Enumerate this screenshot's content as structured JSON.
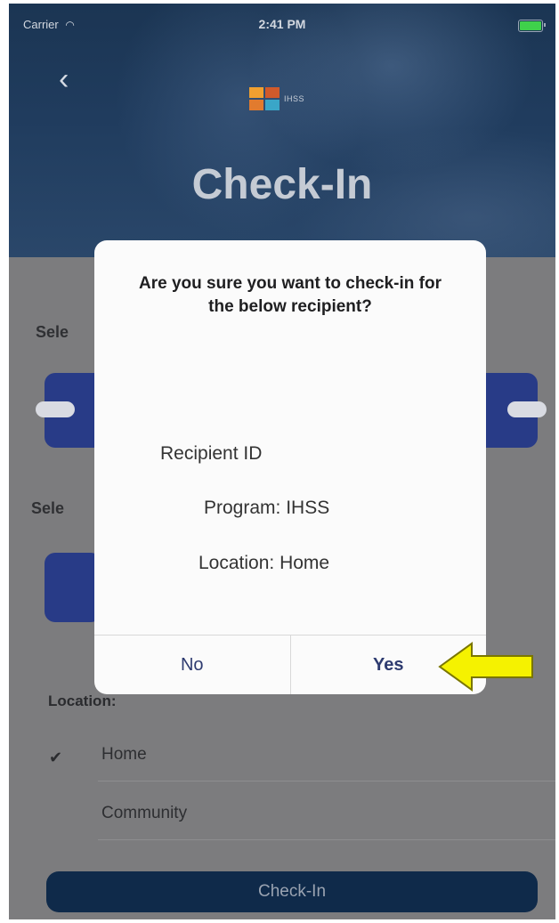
{
  "status_bar": {
    "carrier": "Carrier",
    "wifi_icon": "wifi-icon",
    "time": "2:41 PM",
    "battery_icon": "battery-icon"
  },
  "header": {
    "back_icon": "chevron-left-icon",
    "logo_text": "IHSS",
    "title": "Check-In"
  },
  "content": {
    "select_label_1": "Sele",
    "select_label_2": "Sele",
    "location_label": "Location:",
    "locations": [
      {
        "label": "Home",
        "selected": true
      },
      {
        "label": "Community",
        "selected": false
      }
    ],
    "check_icon": "checkmark-icon",
    "checkin_button": "Check-In"
  },
  "dialog": {
    "message": "Are you sure you want to check-in for the below recipient?",
    "recipient_id": "Recipient ID",
    "program": "Program: IHSS",
    "location": "Location: Home",
    "no_label": "No",
    "yes_label": "Yes"
  },
  "annotation": {
    "arrow_icon": "arrow-left-icon",
    "arrow_color": "#f5f200"
  },
  "colors": {
    "primary_button": "#283b87",
    "dark_button": "#0f2a4a",
    "dialog_action": "#2e3b70"
  }
}
